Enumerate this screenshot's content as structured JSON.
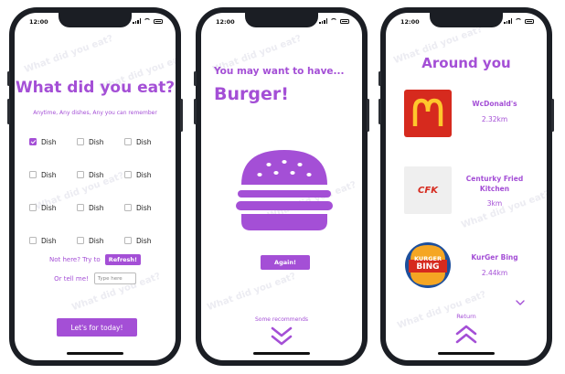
{
  "status": {
    "time": "12:00"
  },
  "screen1": {
    "title": "What did you eat?",
    "subtitle": "Anytime, Any dishes, Any you can remember",
    "dishes": [
      {
        "label": "Dish",
        "checked": true
      },
      {
        "label": "Dish",
        "checked": false
      },
      {
        "label": "Dish",
        "checked": false
      },
      {
        "label": "Dish",
        "checked": false
      },
      {
        "label": "Dish",
        "checked": false
      },
      {
        "label": "Dish",
        "checked": false
      },
      {
        "label": "Dish",
        "checked": false
      },
      {
        "label": "Dish",
        "checked": false
      },
      {
        "label": "Dish",
        "checked": false
      },
      {
        "label": "Dish",
        "checked": false
      },
      {
        "label": "Dish",
        "checked": false
      },
      {
        "label": "Dish",
        "checked": false
      }
    ],
    "not_here": "Not here? Try to",
    "refresh_label": "Refresh!",
    "tell_me": "Or tell me!",
    "tell_placeholder": "Type here",
    "cta_label": "Let's for today!"
  },
  "screen2": {
    "heading": "You may want to have...",
    "dish": "Burger!",
    "again_label": "Again!",
    "recommends_label": "Some recommends"
  },
  "screen3": {
    "title": "Around you",
    "restaurants": [
      {
        "name": "WcDonald's",
        "distance": "2.32km",
        "logo": "mcdonalds-logo"
      },
      {
        "name": "Centurky Fried Kitchen",
        "distance": "3km",
        "logo": "kfc-logo"
      },
      {
        "name": "KurGer Bing",
        "distance": "2.44km",
        "logo": "burger-king-logo"
      }
    ],
    "kfc_logo_text": "CFK",
    "bk_logo_text_top": "KURGER",
    "bk_logo_text_bottom": "BING",
    "return_label": "Return"
  },
  "colors": {
    "accent": "#a44fd6",
    "frame": "#1b1e24"
  },
  "watermark": "What did you eat?"
}
